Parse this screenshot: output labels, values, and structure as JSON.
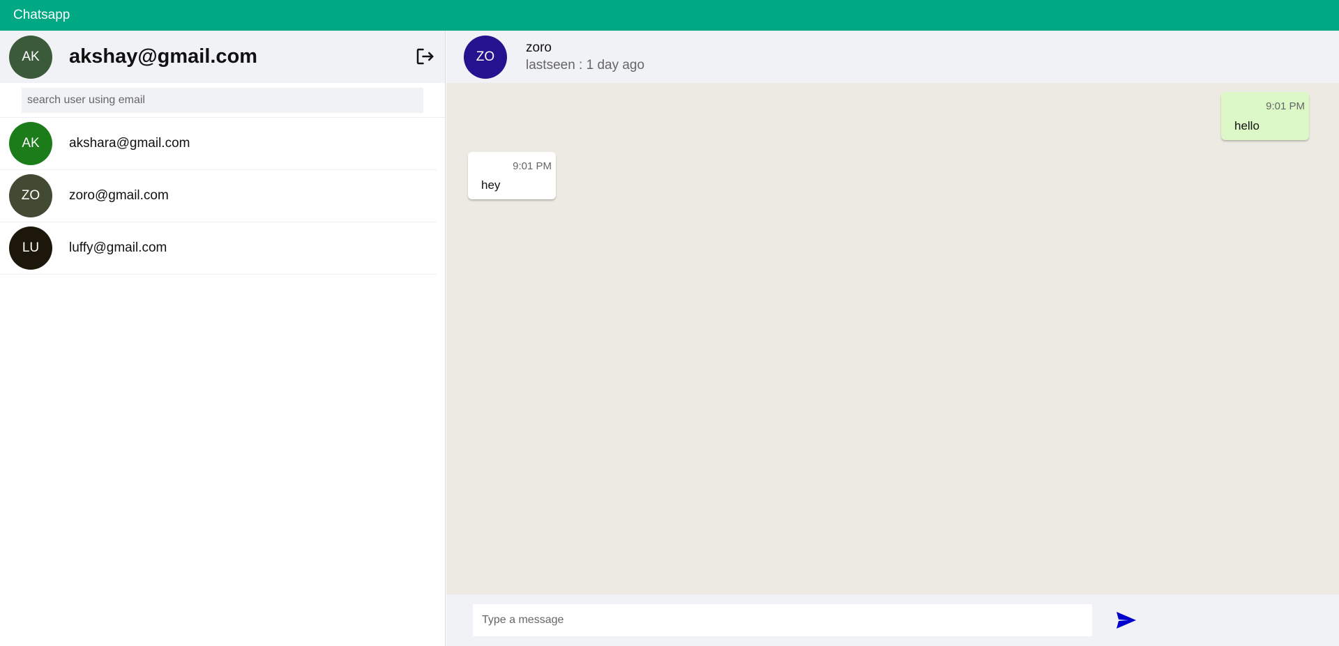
{
  "app": {
    "title": "Chatsapp",
    "accent": "#00a884"
  },
  "current_user": {
    "initials": "AK",
    "email": "akshay@gmail.com",
    "avatar_color": "#3b5a3a"
  },
  "search": {
    "placeholder": "search user using email",
    "value": ""
  },
  "users": [
    {
      "initials": "AK",
      "email": "akshara@gmail.com",
      "avatar_color": "#1c7c1a"
    },
    {
      "initials": "ZO",
      "email": "zoro@gmail.com",
      "avatar_color": "#434a33"
    },
    {
      "initials": "LU",
      "email": "luffy@gmail.com",
      "avatar_color": "#1c170a"
    }
  ],
  "chat": {
    "contact_initials": "ZO",
    "contact_name": "zoro",
    "contact_avatar_color": "#24128e",
    "status": "lastseen : 1 day ago",
    "messages": [
      {
        "direction": "sent",
        "time": "9:01 PM",
        "text": "hello"
      },
      {
        "direction": "received",
        "time": "9:01 PM",
        "text": "hey"
      }
    ]
  },
  "composer": {
    "placeholder": "Type a message",
    "value": "",
    "send_color": "#0000cc"
  },
  "icons": {
    "logout": "logout-icon",
    "send": "send-icon"
  }
}
